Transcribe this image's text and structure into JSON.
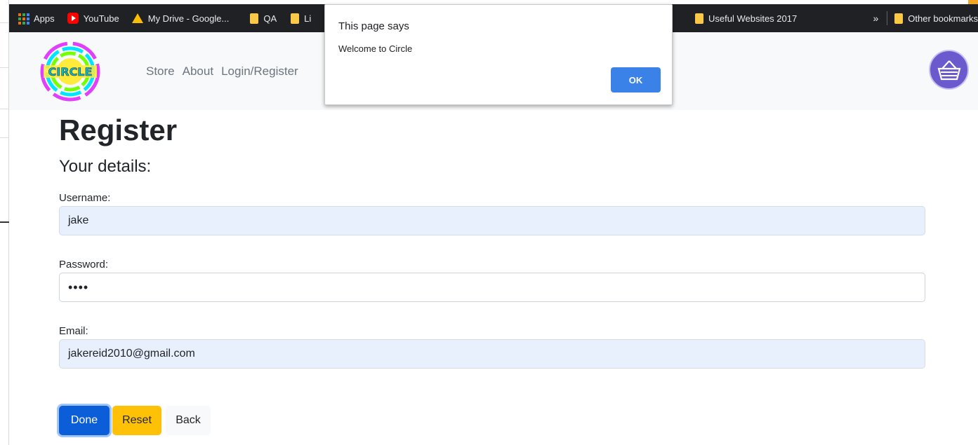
{
  "bookmarks": {
    "items": [
      {
        "label": "Apps",
        "icon": "apps-icon"
      },
      {
        "label": "YouTube",
        "icon": "youtube-icon"
      },
      {
        "label": "My Drive - Google...",
        "icon": "drive-icon"
      },
      {
        "label": "QA",
        "icon": "folder-icon"
      },
      {
        "label": "Li",
        "icon": "folder-icon"
      }
    ],
    "right_folder": "Useful Websites 2017",
    "overflow": "»",
    "other": "Other bookmarks"
  },
  "navbar": {
    "logo_text": "CIRCLE",
    "links": [
      "Store",
      "About",
      "Login/Register"
    ]
  },
  "page": {
    "title": "Register",
    "subtitle": "Your details:",
    "username_label": "Username:",
    "username_value": "jake",
    "password_label": "Password:",
    "password_value": "••••",
    "email_label": "Email:",
    "email_value": "jakereid2010@gmail.com",
    "done": "Done",
    "reset": "Reset",
    "back": "Back"
  },
  "dialog": {
    "title": "This page says",
    "message": "Welcome to Circle",
    "ok": "OK"
  },
  "colors": {
    "primary": "#0b5ed7",
    "warning": "#ffc107",
    "autofill": "#e8f0fe",
    "dialog_ok": "#3b82e8",
    "cart": "#6a5acd"
  }
}
